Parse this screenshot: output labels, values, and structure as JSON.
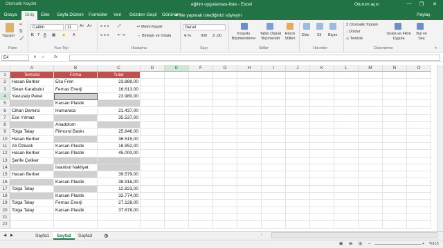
{
  "titlebar": {
    "autosave": "Otomatik Kaydet",
    "title": "eğitim uygulaması-liste - Excel",
    "signin": "Oturum açın",
    "minimize": "—",
    "restore": "❐",
    "close": "✕"
  },
  "tabs": [
    "Dosya",
    "Giriş",
    "Ekle",
    "Sayfa Düzeni",
    "Formüller",
    "Veri",
    "Gözden Geçir",
    "Görünüm"
  ],
  "tellme": "Ne yapmak istediğinizi söyleyin",
  "share": "Paylaş",
  "ribbon": {
    "paste": "Yapıştır",
    "font_name": "Calibri",
    "font_size": "11",
    "wrap_text": "Metni Kaydır",
    "merge_center": "Birleştir ve Ortala",
    "number_format": "Genel",
    "conditional_formatting": "Koşullu Biçimlendirme",
    "format_as_table": "Tablo Olarak Biçimlendir",
    "cell_styles": "Hücre Stilleri",
    "insert": "Ekle",
    "delete": "Sil",
    "format": "Biçim",
    "autosum": "Otomatik Toplam",
    "fill": "Doldur",
    "clear": "Temizle",
    "sort_filter": "Sırala ve Filtre Uygula",
    "find_select": "Bul ve Seç",
    "groups": [
      "Pano",
      "Yazı Tipi",
      "Hizalama",
      "Sayı",
      "Stiller",
      "Hücreler",
      "Düzenleme"
    ]
  },
  "formula_bar": {
    "name_box": "E4",
    "fx": "fx",
    "value": ""
  },
  "columns": [
    "A",
    "B",
    "C",
    "D",
    "E",
    "F",
    "G",
    "H",
    "I",
    "J",
    "K",
    "L",
    "M",
    "N",
    "O"
  ],
  "rows": [
    [
      "Temsilci",
      "Firma",
      "Tutar"
    ],
    [
      "Hasan Berber",
      "Eku Fren",
      "23.889,00"
    ],
    [
      "Sinan Karabulut",
      "Fernas Enerji",
      "16.613,00"
    ],
    [
      "Yavuzalp Pekel",
      "",
      "23.980,00"
    ],
    [
      "",
      "Karsan Plastik",
      ""
    ],
    [
      "Cihan Demirci",
      "Humanica",
      "21.437,00"
    ],
    [
      "Ece Yılmaz",
      "",
      "35.537,00"
    ],
    [
      "",
      "Anadolum",
      ""
    ],
    [
      "Tolga Talay",
      "Filmond Baskı",
      "25.846,00"
    ],
    [
      "Hasan Berber",
      "",
      "36.515,00"
    ],
    [
      "Ali Özkanlı",
      "Karsan Plastik",
      "18.952,00"
    ],
    [
      "Hasan Berber",
      "Karsan Plastik",
      "45.000,00"
    ],
    [
      "Şerife Çeliker",
      "",
      ""
    ],
    [
      "",
      "İstanbul Nakliyat",
      ""
    ],
    [
      "Hasan Berber",
      "",
      "39.579,00"
    ],
    [
      "",
      "Karsan Plastik",
      "38.916,00"
    ],
    [
      "Tolga Talay",
      "",
      "12.823,00"
    ],
    [
      "",
      "Karsan Plastik",
      "32.774,00"
    ],
    [
      "Tolga Talay",
      "Fernas Enerji",
      "27.128,00"
    ],
    [
      "Tolga Talay",
      "Karsan Plastik",
      "37.678,00"
    ]
  ],
  "sheets": [
    "Sayfa1",
    "Sayfa2",
    "Sayfa3"
  ],
  "active_sheet": "Sayfa2",
  "status": {
    "zoom": "%115"
  },
  "colors": {
    "excel_green": "#217346",
    "header_fill": "#c0504d",
    "empty_fill": "#d0d0d0"
  }
}
